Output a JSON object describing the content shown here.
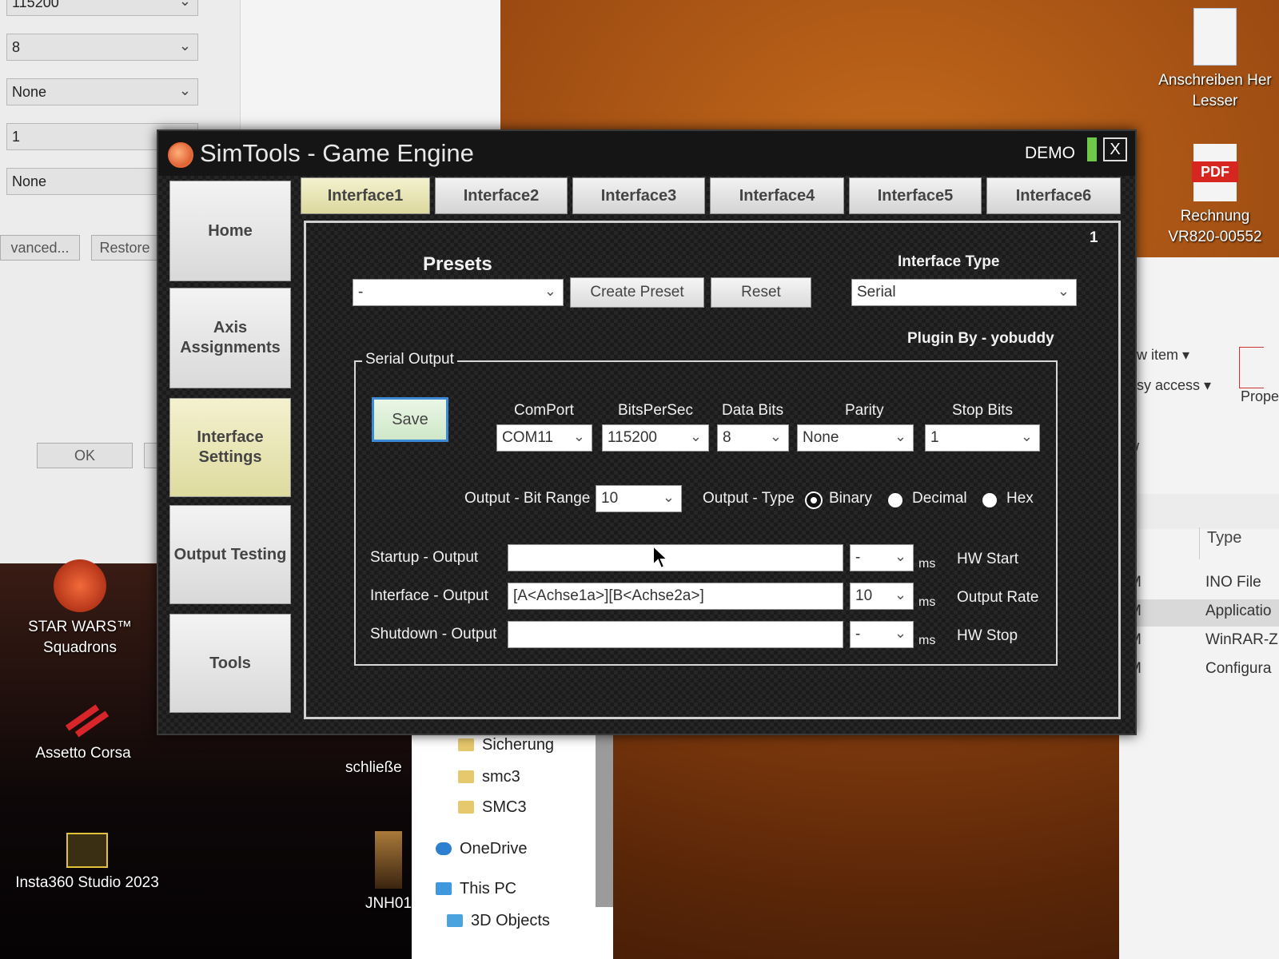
{
  "background_window": {
    "fields": [
      "115200",
      "8",
      "None",
      "1",
      "None"
    ],
    "advanced_button": "vanced...",
    "restore_button": "Restore",
    "ok_button": "OK"
  },
  "desktop_icons": {
    "top_right_1": {
      "label_line1": "Anschreiben Her",
      "label_line2": "Lesser"
    },
    "top_right_2": {
      "label_line1": "Rechnung",
      "label_line2": "VR820-00552",
      "badge": "PDF"
    },
    "star_wars": {
      "label_line1": "STAR WARS™",
      "label_line2": "Squadrons"
    },
    "assetto": {
      "label": "Assetto Corsa"
    },
    "insta360": {
      "label": "Insta360 Studio 2023"
    },
    "schliesse": {
      "label": "schließe"
    },
    "jnh": {
      "label": "JNH01"
    }
  },
  "explorer": {
    "new_item": "ew item ▾",
    "easy_access": "asy access ▾",
    "properties": "Prope",
    "view": "w",
    "type_header": "Type",
    "rows": [
      {
        "time": "M",
        "type": "INO File"
      },
      {
        "time": "M",
        "type": "Applicatio"
      },
      {
        "time": "M",
        "type": "WinRAR-Z"
      },
      {
        "time": "M",
        "type": "Configura"
      }
    ]
  },
  "file_tree": {
    "items": [
      "Sicherung",
      "smc3",
      "SMC3",
      "OneDrive",
      "This PC",
      "3D Objects"
    ]
  },
  "simtools": {
    "title": "SimTools - Game Engine",
    "demo": "DEMO",
    "close": "X",
    "nav": [
      "Home",
      "Axis Assignments",
      "Interface Settings",
      "Output Testing",
      "Tools"
    ],
    "tabs": [
      "Interface1",
      "Interface2",
      "Interface3",
      "Interface4",
      "Interface5",
      "Interface6"
    ],
    "panel_number": "1",
    "presets_label": "Presets",
    "presets_value": "-",
    "create_preset": "Create Preset",
    "reset": "Reset",
    "interface_type_label": "Interface Type",
    "interface_type_value": "Serial",
    "plugin_by": "Plugin By - yobuddy",
    "serial_output_title": "Serial Output",
    "save": "Save",
    "comport_label": "ComPort",
    "comport_value": "COM11",
    "bits_label": "BitsPerSec",
    "bits_value": "115200",
    "databits_label": "Data Bits",
    "databits_value": "8",
    "parity_label": "Parity",
    "parity_value": "None",
    "stopbits_label": "Stop Bits",
    "stopbits_value": "1",
    "bitrange_label": "Output - Bit Range",
    "bitrange_value": "10",
    "outtype_label": "Output - Type",
    "outtype_options": [
      "Binary",
      "Decimal",
      "Hex"
    ],
    "outtype_selected": "Binary",
    "startup_label": "Startup - Output",
    "startup_value": "",
    "startup_ms_value": "-",
    "interface_out_label": "Interface - Output",
    "interface_out_value": "[A<Achse1a>][B<Achse2a>]",
    "interface_ms_value": "10",
    "shutdown_label": "Shutdown - Output",
    "shutdown_value": "",
    "shutdown_ms_value": "-",
    "ms": "ms",
    "hw_start": "HW Start",
    "output_rate": "Output Rate",
    "hw_stop": "HW Stop"
  },
  "colors": {
    "active_tab": "#e9e6b8",
    "save_border": "#3d8ad6",
    "demo_indicator": "#6ec94a"
  }
}
